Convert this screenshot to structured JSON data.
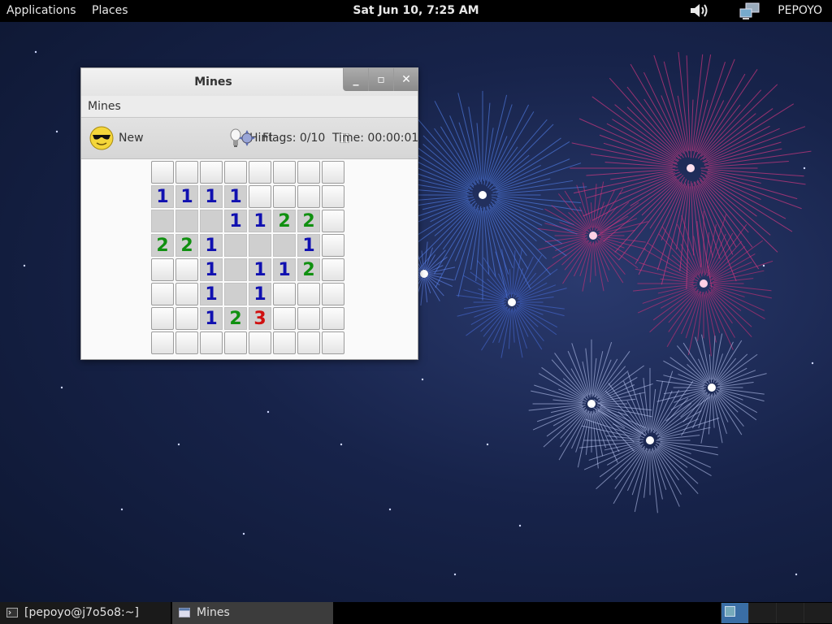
{
  "top_panel": {
    "applications": "Applications",
    "places": "Places",
    "clock": "Sat Jun 10,  7:25 AM",
    "user": "PEPOYO",
    "icons": [
      "volume-icon",
      "network-icon"
    ]
  },
  "window": {
    "title": "Mines",
    "menu": [
      "Mines"
    ],
    "controls": [
      "minimize",
      "maximize",
      "close"
    ]
  },
  "toolbar": {
    "new_label": "New",
    "hint_label": "Hint",
    "flags_label": "Flags: 0/10",
    "time_label": "Time: 00:00:01",
    "icons": [
      "smiley-sunglasses-icon",
      "lightbulb-icon",
      "pause-icon",
      "flag-target-icon"
    ]
  },
  "board": {
    "size": 8,
    "rows": [
      [
        "#",
        "#",
        "#",
        "#",
        "#",
        "#",
        "#",
        "#"
      ],
      [
        "1",
        "1",
        "1",
        "1",
        "#",
        "#",
        "#",
        "#"
      ],
      [
        ".",
        ".",
        ".",
        "1",
        "1",
        "2",
        "2",
        "#"
      ],
      [
        "2",
        "2",
        "1",
        ".",
        ".",
        ".",
        "1",
        "#"
      ],
      [
        "#",
        "#",
        "1",
        ".",
        "1",
        "1",
        "2",
        "#"
      ],
      [
        "#",
        "#",
        "1",
        ".",
        "1",
        "#",
        "#",
        "#"
      ],
      [
        "#",
        "#",
        "1",
        "2",
        "3",
        "#",
        "#",
        "#"
      ],
      [
        "#",
        "#",
        "#",
        "#",
        "#",
        "#",
        "#",
        "#"
      ]
    ],
    "number_colors": {
      "1": "#1010b0",
      "2": "#109010",
      "3": "#d01010"
    }
  },
  "taskbar": {
    "tasks": [
      {
        "label": "[pepoyo@j7o5o8:~]",
        "icon": "terminal-icon"
      },
      {
        "label": "Mines",
        "icon": "window-icon"
      }
    ],
    "workspaces": 4,
    "active_workspace": 1
  }
}
